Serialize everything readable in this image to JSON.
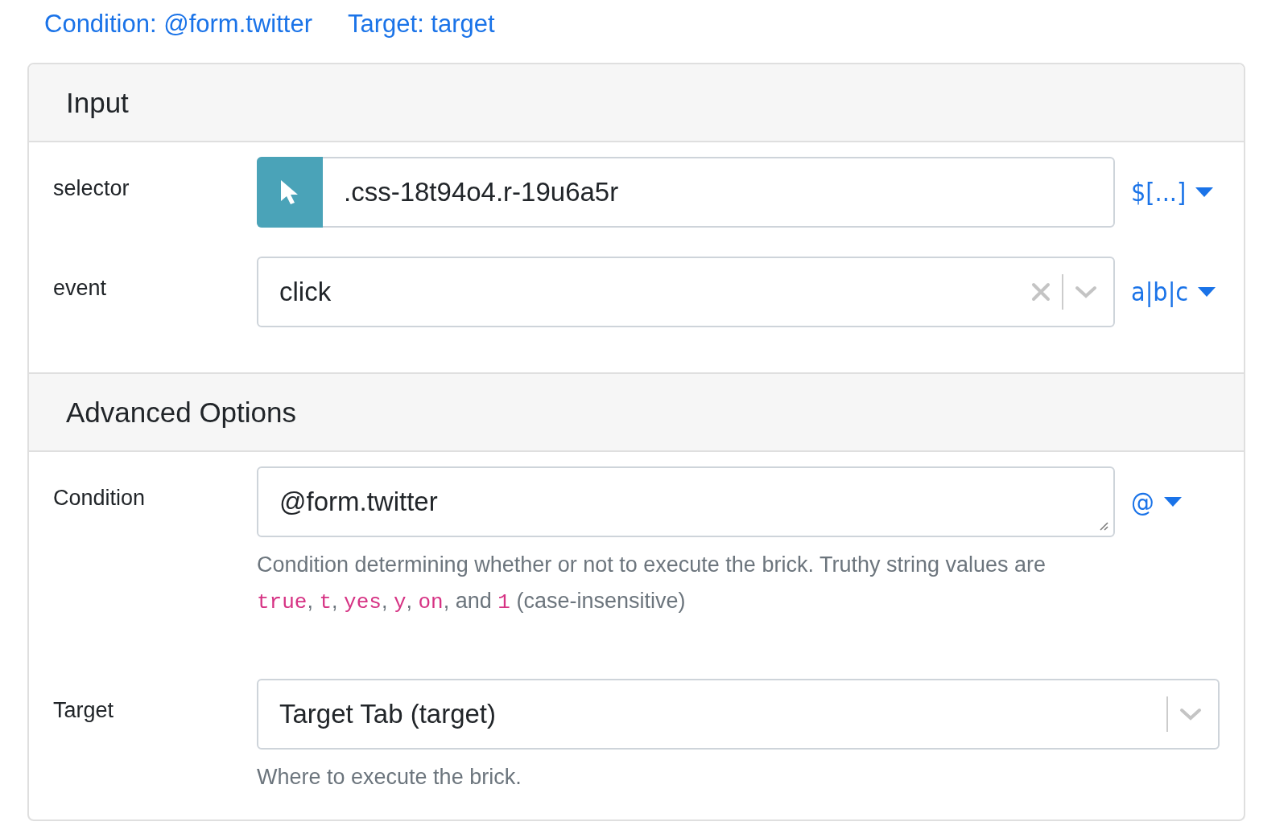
{
  "links": [
    "Condition: @form.twitter",
    "Target: target"
  ],
  "sections": [
    {
      "title": "Input",
      "fields": [
        {
          "label": "selector",
          "kind": "selector",
          "value": ".css-18t94o4.r-19u6a5r",
          "toggle": "$[...]"
        },
        {
          "label": "event",
          "kind": "select",
          "value": "click",
          "clearable": true,
          "toggle": "a|b|c"
        }
      ]
    },
    {
      "title": "Advanced Options",
      "fields": [
        {
          "label": "Condition",
          "kind": "textarea",
          "value": "@form.twitter",
          "toggle": "@",
          "help": [
            {
              "kind": "text",
              "text": "Condition determining whether or not to execute the brick. Truthy string values are "
            },
            {
              "kind": "code",
              "text": "true"
            },
            {
              "kind": "text",
              "text": ", "
            },
            {
              "kind": "code",
              "text": "t"
            },
            {
              "kind": "text",
              "text": ", "
            },
            {
              "kind": "code",
              "text": "yes"
            },
            {
              "kind": "text",
              "text": ", "
            },
            {
              "kind": "code",
              "text": "y"
            },
            {
              "kind": "text",
              "text": ", "
            },
            {
              "kind": "code",
              "text": "on"
            },
            {
              "kind": "text",
              "text": ", and "
            },
            {
              "kind": "code",
              "text": "1"
            },
            {
              "kind": "text",
              "text": " (case-insensitive)"
            }
          ]
        },
        {
          "label": "Target",
          "kind": "select",
          "value": "Target Tab (target)",
          "clearable": false,
          "help": [
            {
              "kind": "text",
              "text": "Where to execute the brick."
            }
          ]
        }
      ]
    }
  ]
}
